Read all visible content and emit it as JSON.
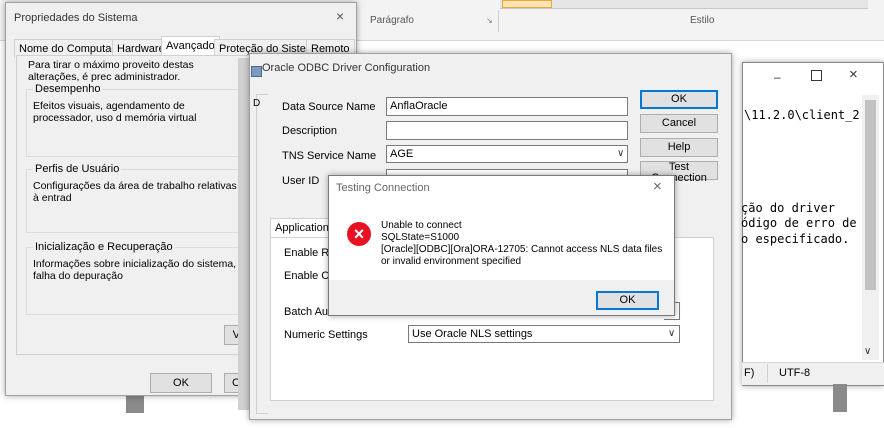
{
  "ribbon": {
    "paragraph_label": "Parágrafo",
    "style_label": "Estilo"
  },
  "notepad": {
    "line1": "\\11.2.0\\client_2",
    "line2": "ção do driver",
    "line3": "ódigo de erro de",
    "line4": "o especificado.",
    "status_suffix": "F)",
    "encoding": "UTF-8"
  },
  "system_props": {
    "title": "Propriedades do Sistema",
    "tabs": [
      "Nome do Computador",
      "Hardware",
      "Avançado",
      "Proteção do Sistema",
      "Remoto"
    ],
    "intro": "Para tirar o máximo proveito destas alterações, é prec administrador.",
    "groups": [
      {
        "title": "Desempenho",
        "text": "Efeitos visuais, agendamento de processador, uso d memória virtual"
      },
      {
        "title": "Perfis de Usuário",
        "text": "Configurações da área de trabalho relativas à entrad"
      },
      {
        "title": "Inicialização e Recuperação",
        "text": "Informações sobre inicialização do sistema, falha do depuração"
      }
    ],
    "va_button": "Va",
    "ok": "OK",
    "cancel_partial": "Ca"
  },
  "odbc": {
    "title": "Oracle ODBC Driver Configuration",
    "labels": {
      "dsn": "Data Source Name",
      "description": "Description",
      "tns": "TNS Service Name",
      "userid": "User ID"
    },
    "values": {
      "dsn": "AnflaOracle",
      "description": "",
      "tns": "AGE"
    },
    "buttons": {
      "ok": "OK",
      "cancel": "Cancel",
      "help": "Help",
      "test": "Test Connection"
    },
    "tab_application": "Application",
    "enable_res": "Enable Res",
    "enable_clos": "Enable Clos",
    "batch_auto": "Batch Auto",
    "numeric_settings": "Numeric Settings",
    "numeric_value": "Use Oracle NLS settings"
  },
  "testing": {
    "title": "Testing Connection",
    "lines": [
      "Unable to connect",
      "SQLState=S1000",
      "[Oracle][ODBC][Ora]ORA-12705: Cannot access NLS data files",
      "or invalid environment specified"
    ],
    "ok": "OK"
  },
  "colors": {
    "error_red": "#e81123",
    "accent": "#0078d7"
  }
}
